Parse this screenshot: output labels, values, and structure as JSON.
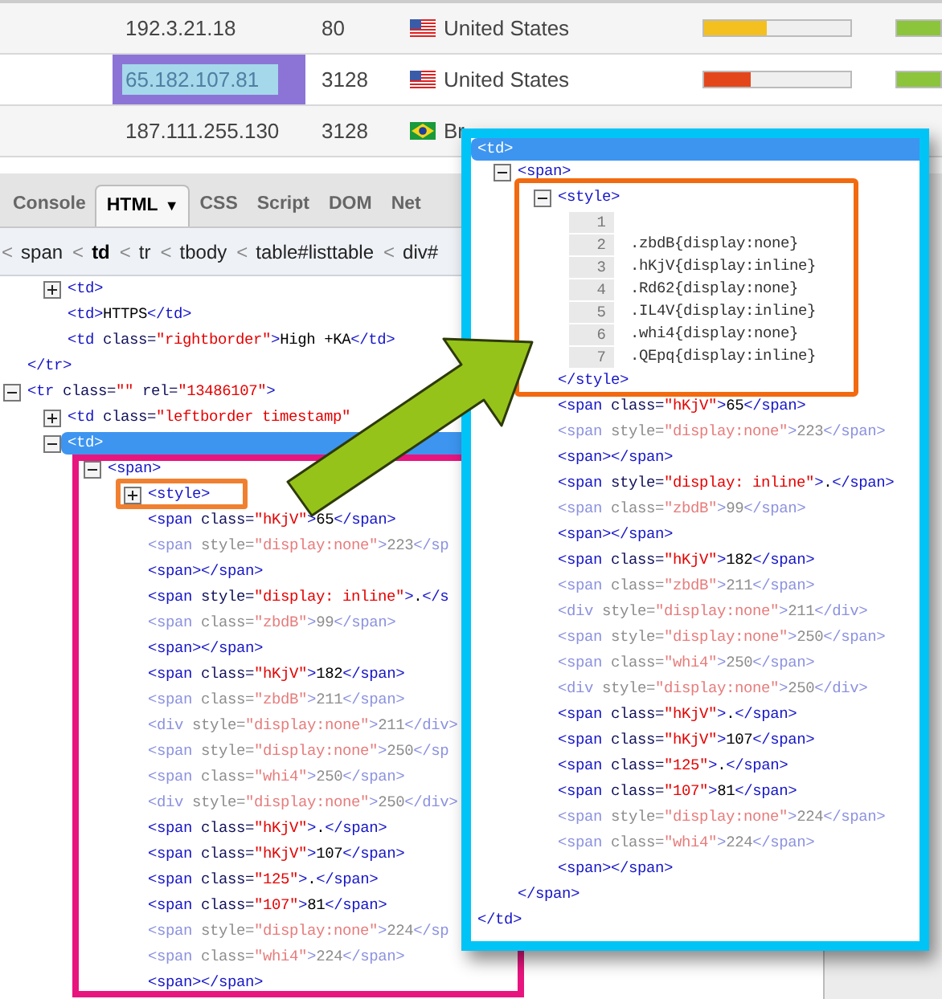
{
  "table": {
    "rows": [
      {
        "ip": {
          "text": "192.3.21.18",
          "selected": false
        },
        "port": "80",
        "flag": {
          "kind": "us"
        },
        "country": "United States",
        "bars": [
          {
            "kind": "speed",
            "level": 0.43,
            "color": "#f4c020"
          },
          {
            "kind": "uptime",
            "level": 1,
            "color": "#8cc43c"
          }
        ]
      },
      {
        "ip": {
          "text": "65.182.107.81",
          "selected": true
        },
        "port": "3128",
        "flag": {
          "kind": "us"
        },
        "country": "United States",
        "bars": [
          {
            "kind": "speed",
            "level": 0.32,
            "color": "#e4461c"
          },
          {
            "kind": "uptime",
            "level": 1,
            "color": "#8cc43c"
          }
        ]
      },
      {
        "ip": {
          "text": "187.111.255.130",
          "selected": false
        },
        "port": "3128",
        "flag": {
          "kind": "br"
        },
        "country": "Br"
      }
    ]
  },
  "devtools": {
    "tabs": [
      {
        "label": "Console",
        "selected": false
      },
      {
        "label": "HTML",
        "selected": true,
        "caret": "▼"
      },
      {
        "label": "CSS",
        "selected": false
      },
      {
        "label": "Script",
        "selected": false
      },
      {
        "label": "DOM",
        "selected": false
      },
      {
        "label": "Net",
        "selected": false
      }
    ],
    "breadcrumbs": [
      {
        "separator": "<",
        "label": "span",
        "selected": false
      },
      {
        "separator": "<",
        "label": "td",
        "selected": true
      },
      {
        "separator": "<",
        "label": "tr",
        "selected": false
      },
      {
        "separator": "<",
        "label": "tbody",
        "selected": false
      },
      {
        "separator": "<",
        "label": "table#listtable",
        "selected": false
      },
      {
        "separator": "<",
        "label": "div#",
        "selected": false
      }
    ],
    "tree": [
      {
        "children": [
          {
            "tokens": [
              {
                "text": "<td>",
                "kind": "tag"
              }
            ],
            "expanded": false,
            "selected": false,
            "dimmed": false
          },
          {
            "tokens": [
              {
                "text": "<td>",
                "kind": "tag"
              },
              {
                "text": "HTTPS",
                "kind": "text"
              },
              {
                "text": "</td>",
                "kind": "tag"
              }
            ],
            "selected": false,
            "dimmed": false
          },
          {
            "tokens": [
              {
                "text": "<td",
                "kind": "tag"
              },
              {
                "text": " class=",
                "kind": "attr"
              },
              {
                "text": "\"rightborder\"",
                "kind": "value"
              },
              {
                "text": ">",
                "kind": "tag"
              },
              {
                "text": "High +KA",
                "kind": "text"
              },
              {
                "text": "</td>",
                "kind": "tag"
              }
            ],
            "selected": false,
            "dimmed": false
          }
        ],
        "close_tokens": [
          {
            "text": "</tr>",
            "kind": "tag"
          }
        ]
      },
      {
        "tokens": [
          {
            "text": "<tr",
            "kind": "tag"
          },
          {
            "text": " class=",
            "kind": "attr"
          },
          {
            "text": "\"\"",
            "kind": "value"
          },
          {
            "text": " rel=",
            "kind": "attr"
          },
          {
            "text": "\"13486107\"",
            "kind": "value"
          },
          {
            "text": ">",
            "kind": "tag"
          }
        ],
        "expanded": true,
        "selected": false,
        "dimmed": false,
        "children": [
          {
            "tokens": [
              {
                "text": "<td",
                "kind": "tag"
              },
              {
                "text": " class=",
                "kind": "attr"
              },
              {
                "text": "\"leftborder timestamp\"",
                "kind": "value"
              }
            ],
            "expanded": false,
            "selected": false,
            "dimmed": false
          },
          {
            "tokens": [
              {
                "text": "<td>",
                "kind": "tag"
              }
            ],
            "expanded": true,
            "selected": true,
            "children": [
              {
                "tokens": [
                  {
                    "text": "<span>",
                    "kind": "tag"
                  }
                ],
                "expanded": true,
                "selected": false,
                "dimmed": false,
                "children": [
                  {
                    "tokens": [
                      {
                        "text": "<style>",
                        "kind": "tag"
                      }
                    ],
                    "expanded": false,
                    "selected": false,
                    "dimmed": false
                  },
                  {
                    "tokens": [
                      {
                        "text": "<span",
                        "kind": "tag"
                      },
                      {
                        "text": " class=",
                        "kind": "attr"
                      },
                      {
                        "text": "\"hKjV\"",
                        "kind": "value"
                      },
                      {
                        "text": ">",
                        "kind": "tag"
                      },
                      {
                        "text": "65",
                        "kind": "text"
                      },
                      {
                        "text": "</span>",
                        "kind": "tag"
                      }
                    ],
                    "selected": false,
                    "dimmed": false
                  },
                  {
                    "tokens": [
                      {
                        "text": "<span",
                        "kind": "tag"
                      },
                      {
                        "text": " style=",
                        "kind": "attr"
                      },
                      {
                        "text": "\"display:none\"",
                        "kind": "value"
                      },
                      {
                        "text": ">",
                        "kind": "tag"
                      },
                      {
                        "text": "223",
                        "kind": "text"
                      },
                      {
                        "text": "</sp",
                        "kind": "tag"
                      }
                    ],
                    "selected": false,
                    "dimmed": true
                  },
                  {
                    "tokens": [
                      {
                        "text": "<span>",
                        "kind": "tag"
                      },
                      {
                        "text": "</span>",
                        "kind": "tag"
                      }
                    ],
                    "selected": false,
                    "dimmed": false
                  },
                  {
                    "tokens": [
                      {
                        "text": "<span",
                        "kind": "tag"
                      },
                      {
                        "text": " style=",
                        "kind": "attr"
                      },
                      {
                        "text": "\"display: inline\"",
                        "kind": "value"
                      },
                      {
                        "text": ">",
                        "kind": "tag"
                      },
                      {
                        "text": ".",
                        "kind": "text"
                      },
                      {
                        "text": "</s",
                        "kind": "tag"
                      }
                    ],
                    "selected": false,
                    "dimmed": false
                  },
                  {
                    "tokens": [
                      {
                        "text": "<span",
                        "kind": "tag"
                      },
                      {
                        "text": " class=",
                        "kind": "attr"
                      },
                      {
                        "text": "\"zbdB\"",
                        "kind": "value"
                      },
                      {
                        "text": ">",
                        "kind": "tag"
                      },
                      {
                        "text": "99",
                        "kind": "text"
                      },
                      {
                        "text": "</span>",
                        "kind": "tag"
                      }
                    ],
                    "selected": false,
                    "dimmed": true
                  },
                  {
                    "tokens": [
                      {
                        "text": "<span>",
                        "kind": "tag"
                      },
                      {
                        "text": "</span>",
                        "kind": "tag"
                      }
                    ],
                    "selected": false,
                    "dimmed": false
                  },
                  {
                    "tokens": [
                      {
                        "text": "<span",
                        "kind": "tag"
                      },
                      {
                        "text": " class=",
                        "kind": "attr"
                      },
                      {
                        "text": "\"hKjV\"",
                        "kind": "value"
                      },
                      {
                        "text": ">",
                        "kind": "tag"
                      },
                      {
                        "text": "182",
                        "kind": "text"
                      },
                      {
                        "text": "</span>",
                        "kind": "tag"
                      }
                    ],
                    "selected": false,
                    "dimmed": false
                  },
                  {
                    "tokens": [
                      {
                        "text": "<span",
                        "kind": "tag"
                      },
                      {
                        "text": " class=",
                        "kind": "attr"
                      },
                      {
                        "text": "\"zbdB\"",
                        "kind": "value"
                      },
                      {
                        "text": ">",
                        "kind": "tag"
                      },
                      {
                        "text": "211",
                        "kind": "text"
                      },
                      {
                        "text": "</span>",
                        "kind": "tag"
                      }
                    ],
                    "selected": false,
                    "dimmed": true
                  },
                  {
                    "tokens": [
                      {
                        "text": "<div",
                        "kind": "tag"
                      },
                      {
                        "text": " style=",
                        "kind": "attr"
                      },
                      {
                        "text": "\"display:none\"",
                        "kind": "value"
                      },
                      {
                        "text": ">",
                        "kind": "tag"
                      },
                      {
                        "text": "211",
                        "kind": "text"
                      },
                      {
                        "text": "</div>",
                        "kind": "tag"
                      }
                    ],
                    "selected": false,
                    "dimmed": true
                  },
                  {
                    "tokens": [
                      {
                        "text": "<span",
                        "kind": "tag"
                      },
                      {
                        "text": " style=",
                        "kind": "attr"
                      },
                      {
                        "text": "\"display:none\"",
                        "kind": "value"
                      },
                      {
                        "text": ">",
                        "kind": "tag"
                      },
                      {
                        "text": "250",
                        "kind": "text"
                      },
                      {
                        "text": "</sp",
                        "kind": "tag"
                      }
                    ],
                    "selected": false,
                    "dimmed": true
                  },
                  {
                    "tokens": [
                      {
                        "text": "<span",
                        "kind": "tag"
                      },
                      {
                        "text": " class=",
                        "kind": "attr"
                      },
                      {
                        "text": "\"whi4\"",
                        "kind": "value"
                      },
                      {
                        "text": ">",
                        "kind": "tag"
                      },
                      {
                        "text": "250",
                        "kind": "text"
                      },
                      {
                        "text": "</span>",
                        "kind": "tag"
                      }
                    ],
                    "selected": false,
                    "dimmed": true
                  },
                  {
                    "tokens": [
                      {
                        "text": "<div",
                        "kind": "tag"
                      },
                      {
                        "text": " style=",
                        "kind": "attr"
                      },
                      {
                        "text": "\"display:none\"",
                        "kind": "value"
                      },
                      {
                        "text": ">",
                        "kind": "tag"
                      },
                      {
                        "text": "250",
                        "kind": "text"
                      },
                      {
                        "text": "</div>",
                        "kind": "tag"
                      }
                    ],
                    "selected": false,
                    "dimmed": true
                  },
                  {
                    "tokens": [
                      {
                        "text": "<span",
                        "kind": "tag"
                      },
                      {
                        "text": " class=",
                        "kind": "attr"
                      },
                      {
                        "text": "\"hKjV\"",
                        "kind": "value"
                      },
                      {
                        "text": ">",
                        "kind": "tag"
                      },
                      {
                        "text": ".",
                        "kind": "text"
                      },
                      {
                        "text": "</span>",
                        "kind": "tag"
                      }
                    ],
                    "selected": false,
                    "dimmed": false
                  },
                  {
                    "tokens": [
                      {
                        "text": "<span",
                        "kind": "tag"
                      },
                      {
                        "text": " class=",
                        "kind": "attr"
                      },
                      {
                        "text": "\"hKjV\"",
                        "kind": "value"
                      },
                      {
                        "text": ">",
                        "kind": "tag"
                      },
                      {
                        "text": "107",
                        "kind": "text"
                      },
                      {
                        "text": "</span>",
                        "kind": "tag"
                      }
                    ],
                    "selected": false,
                    "dimmed": false
                  },
                  {
                    "tokens": [
                      {
                        "text": "<span",
                        "kind": "tag"
                      },
                      {
                        "text": " class=",
                        "kind": "attr"
                      },
                      {
                        "text": "\"125\"",
                        "kind": "value"
                      },
                      {
                        "text": ">",
                        "kind": "tag"
                      },
                      {
                        "text": ".",
                        "kind": "text"
                      },
                      {
                        "text": "</span>",
                        "kind": "tag"
                      }
                    ],
                    "selected": false,
                    "dimmed": false
                  },
                  {
                    "tokens": [
                      {
                        "text": "<span",
                        "kind": "tag"
                      },
                      {
                        "text": " class=",
                        "kind": "attr"
                      },
                      {
                        "text": "\"107\"",
                        "kind": "value"
                      },
                      {
                        "text": ">",
                        "kind": "tag"
                      },
                      {
                        "text": "81",
                        "kind": "text"
                      },
                      {
                        "text": "</span>",
                        "kind": "tag"
                      }
                    ],
                    "selected": false,
                    "dimmed": false
                  },
                  {
                    "tokens": [
                      {
                        "text": "<span",
                        "kind": "tag"
                      },
                      {
                        "text": " style=",
                        "kind": "attr"
                      },
                      {
                        "text": "\"display:none\"",
                        "kind": "value"
                      },
                      {
                        "text": ">",
                        "kind": "tag"
                      },
                      {
                        "text": "224",
                        "kind": "text"
                      },
                      {
                        "text": "</sp",
                        "kind": "tag"
                      }
                    ],
                    "selected": false,
                    "dimmed": true
                  },
                  {
                    "tokens": [
                      {
                        "text": "<span",
                        "kind": "tag"
                      },
                      {
                        "text": " class=",
                        "kind": "attr"
                      },
                      {
                        "text": "\"whi4\"",
                        "kind": "value"
                      },
                      {
                        "text": ">",
                        "kind": "tag"
                      },
                      {
                        "text": "224",
                        "kind": "text"
                      },
                      {
                        "text": "</span>",
                        "kind": "tag"
                      }
                    ],
                    "selected": false,
                    "dimmed": true
                  },
                  {
                    "tokens": [
                      {
                        "text": "<span>",
                        "kind": "tag"
                      },
                      {
                        "text": "</span>",
                        "kind": "tag"
                      }
                    ],
                    "selected": false,
                    "dimmed": false
                  }
                ]
              }
            ]
          }
        ]
      }
    ]
  },
  "callout": {
    "tree": [
      {
        "tokens": [
          {
            "text": "<td>",
            "kind": "tag"
          }
        ],
        "selected": true,
        "children": [
          {
            "tokens": [
              {
                "text": "<span>",
                "kind": "tag"
              }
            ],
            "expanded": true,
            "selected": false,
            "dimmed": false,
            "children": [
              {
                "tokens": [
                  {
                    "text": "<style>",
                    "kind": "tag"
                  }
                ],
                "expanded": true,
                "selected": false,
                "dimmed": false,
                "css_lines": [
                  {
                    "number": "1"
                  },
                  {
                    "number": "2",
                    "text": ".zbdB{display:none}"
                  },
                  {
                    "number": "3",
                    "text": ".hKjV{display:inline}"
                  },
                  {
                    "number": "4",
                    "text": ".Rd62{display:none}"
                  },
                  {
                    "number": "5",
                    "text": ".IL4V{display:inline}"
                  },
                  {
                    "number": "6",
                    "text": ".whi4{display:none}"
                  },
                  {
                    "number": "7",
                    "text": ".QEpq{display:inline}"
                  }
                ],
                "close_tokens": [
                  {
                    "text": "</style>",
                    "kind": "tag"
                  }
                ]
              },
              {
                "tokens": [
                  {
                    "text": "<span",
                    "kind": "tag"
                  },
                  {
                    "text": " class=",
                    "kind": "attr"
                  },
                  {
                    "text": "\"hKjV\"",
                    "kind": "value"
                  },
                  {
                    "text": ">",
                    "kind": "tag"
                  },
                  {
                    "text": "65",
                    "kind": "text"
                  },
                  {
                    "text": "</span>",
                    "kind": "tag"
                  }
                ],
                "selected": false,
                "dimmed": false
              },
              {
                "tokens": [
                  {
                    "text": "<span",
                    "kind": "tag"
                  },
                  {
                    "text": " style=",
                    "kind": "attr"
                  },
                  {
                    "text": "\"display:none\"",
                    "kind": "value"
                  },
                  {
                    "text": ">",
                    "kind": "tag"
                  },
                  {
                    "text": "223",
                    "kind": "text"
                  },
                  {
                    "text": "</span>",
                    "kind": "tag"
                  }
                ],
                "selected": false,
                "dimmed": true
              },
              {
                "tokens": [
                  {
                    "text": "<span>",
                    "kind": "tag"
                  },
                  {
                    "text": "</span>",
                    "kind": "tag"
                  }
                ],
                "selected": false,
                "dimmed": false
              },
              {
                "tokens": [
                  {
                    "text": "<span",
                    "kind": "tag"
                  },
                  {
                    "text": " style=",
                    "kind": "attr"
                  },
                  {
                    "text": "\"display: inline\"",
                    "kind": "value"
                  },
                  {
                    "text": ">",
                    "kind": "tag"
                  },
                  {
                    "text": ".",
                    "kind": "text"
                  },
                  {
                    "text": "</span>",
                    "kind": "tag"
                  }
                ],
                "selected": false,
                "dimmed": false
              },
              {
                "tokens": [
                  {
                    "text": "<span",
                    "kind": "tag"
                  },
                  {
                    "text": " class=",
                    "kind": "attr"
                  },
                  {
                    "text": "\"zbdB\"",
                    "kind": "value"
                  },
                  {
                    "text": ">",
                    "kind": "tag"
                  },
                  {
                    "text": "99",
                    "kind": "text"
                  },
                  {
                    "text": "</span>",
                    "kind": "tag"
                  }
                ],
                "selected": false,
                "dimmed": true
              },
              {
                "tokens": [
                  {
                    "text": "<span>",
                    "kind": "tag"
                  },
                  {
                    "text": "</span>",
                    "kind": "tag"
                  }
                ],
                "selected": false,
                "dimmed": false
              },
              {
                "tokens": [
                  {
                    "text": "<span",
                    "kind": "tag"
                  },
                  {
                    "text": " class=",
                    "kind": "attr"
                  },
                  {
                    "text": "\"hKjV\"",
                    "kind": "value"
                  },
                  {
                    "text": ">",
                    "kind": "tag"
                  },
                  {
                    "text": "182",
                    "kind": "text"
                  },
                  {
                    "text": "</span>",
                    "kind": "tag"
                  }
                ],
                "selected": false,
                "dimmed": false
              },
              {
                "tokens": [
                  {
                    "text": "<span",
                    "kind": "tag"
                  },
                  {
                    "text": " class=",
                    "kind": "attr"
                  },
                  {
                    "text": "\"zbdB\"",
                    "kind": "value"
                  },
                  {
                    "text": ">",
                    "kind": "tag"
                  },
                  {
                    "text": "211",
                    "kind": "text"
                  },
                  {
                    "text": "</span>",
                    "kind": "tag"
                  }
                ],
                "selected": false,
                "dimmed": true
              },
              {
                "tokens": [
                  {
                    "text": "<div",
                    "kind": "tag"
                  },
                  {
                    "text": " style=",
                    "kind": "attr"
                  },
                  {
                    "text": "\"display:none\"",
                    "kind": "value"
                  },
                  {
                    "text": ">",
                    "kind": "tag"
                  },
                  {
                    "text": "211",
                    "kind": "text"
                  },
                  {
                    "text": "</div>",
                    "kind": "tag"
                  }
                ],
                "selected": false,
                "dimmed": true
              },
              {
                "tokens": [
                  {
                    "text": "<span",
                    "kind": "tag"
                  },
                  {
                    "text": " style=",
                    "kind": "attr"
                  },
                  {
                    "text": "\"display:none\"",
                    "kind": "value"
                  },
                  {
                    "text": ">",
                    "kind": "tag"
                  },
                  {
                    "text": "250",
                    "kind": "text"
                  },
                  {
                    "text": "</span>",
                    "kind": "tag"
                  }
                ],
                "selected": false,
                "dimmed": true
              },
              {
                "tokens": [
                  {
                    "text": "<span",
                    "kind": "tag"
                  },
                  {
                    "text": " class=",
                    "kind": "attr"
                  },
                  {
                    "text": "\"whi4\"",
                    "kind": "value"
                  },
                  {
                    "text": ">",
                    "kind": "tag"
                  },
                  {
                    "text": "250",
                    "kind": "text"
                  },
                  {
                    "text": "</span>",
                    "kind": "tag"
                  }
                ],
                "selected": false,
                "dimmed": true
              },
              {
                "tokens": [
                  {
                    "text": "<div",
                    "kind": "tag"
                  },
                  {
                    "text": " style=",
                    "kind": "attr"
                  },
                  {
                    "text": "\"display:none\"",
                    "kind": "value"
                  },
                  {
                    "text": ">",
                    "kind": "tag"
                  },
                  {
                    "text": "250",
                    "kind": "text"
                  },
                  {
                    "text": "</div>",
                    "kind": "tag"
                  }
                ],
                "selected": false,
                "dimmed": true
              },
              {
                "tokens": [
                  {
                    "text": "<span",
                    "kind": "tag"
                  },
                  {
                    "text": " class=",
                    "kind": "attr"
                  },
                  {
                    "text": "\"hKjV\"",
                    "kind": "value"
                  },
                  {
                    "text": ">",
                    "kind": "tag"
                  },
                  {
                    "text": ".",
                    "kind": "text"
                  },
                  {
                    "text": "</span>",
                    "kind": "tag"
                  }
                ],
                "selected": false,
                "dimmed": false
              },
              {
                "tokens": [
                  {
                    "text": "<span",
                    "kind": "tag"
                  },
                  {
                    "text": " class=",
                    "kind": "attr"
                  },
                  {
                    "text": "\"hKjV\"",
                    "kind": "value"
                  },
                  {
                    "text": ">",
                    "kind": "tag"
                  },
                  {
                    "text": "107",
                    "kind": "text"
                  },
                  {
                    "text": "</span>",
                    "kind": "tag"
                  }
                ],
                "selected": false,
                "dimmed": false
              },
              {
                "tokens": [
                  {
                    "text": "<span",
                    "kind": "tag"
                  },
                  {
                    "text": " class=",
                    "kind": "attr"
                  },
                  {
                    "text": "\"125\"",
                    "kind": "value"
                  },
                  {
                    "text": ">",
                    "kind": "tag"
                  },
                  {
                    "text": ".",
                    "kind": "text"
                  },
                  {
                    "text": "</span>",
                    "kind": "tag"
                  }
                ],
                "selected": false,
                "dimmed": false
              },
              {
                "tokens": [
                  {
                    "text": "<span",
                    "kind": "tag"
                  },
                  {
                    "text": " class=",
                    "kind": "attr"
                  },
                  {
                    "text": "\"107\"",
                    "kind": "value"
                  },
                  {
                    "text": ">",
                    "kind": "tag"
                  },
                  {
                    "text": "81",
                    "kind": "text"
                  },
                  {
                    "text": "</span>",
                    "kind": "tag"
                  }
                ],
                "selected": false,
                "dimmed": false
              },
              {
                "tokens": [
                  {
                    "text": "<span",
                    "kind": "tag"
                  },
                  {
                    "text": " style=",
                    "kind": "attr"
                  },
                  {
                    "text": "\"display:none\"",
                    "kind": "value"
                  },
                  {
                    "text": ">",
                    "kind": "tag"
                  },
                  {
                    "text": "224",
                    "kind": "text"
                  },
                  {
                    "text": "</span>",
                    "kind": "tag"
                  }
                ],
                "selected": false,
                "dimmed": true
              },
              {
                "tokens": [
                  {
                    "text": "<span",
                    "kind": "tag"
                  },
                  {
                    "text": " class=",
                    "kind": "attr"
                  },
                  {
                    "text": "\"whi4\"",
                    "kind": "value"
                  },
                  {
                    "text": ">",
                    "kind": "tag"
                  },
                  {
                    "text": "224",
                    "kind": "text"
                  },
                  {
                    "text": "</span>",
                    "kind": "tag"
                  }
                ],
                "selected": false,
                "dimmed": true
              },
              {
                "tokens": [
                  {
                    "text": "<span>",
                    "kind": "tag"
                  },
                  {
                    "text": "</span>",
                    "kind": "tag"
                  }
                ],
                "selected": false,
                "dimmed": false
              }
            ],
            "close_tokens": [
              {
                "text": "</span>",
                "kind": "tag"
              }
            ]
          }
        ],
        "close_tokens": [
          {
            "text": "</td>",
            "kind": "tag"
          }
        ]
      }
    ]
  }
}
